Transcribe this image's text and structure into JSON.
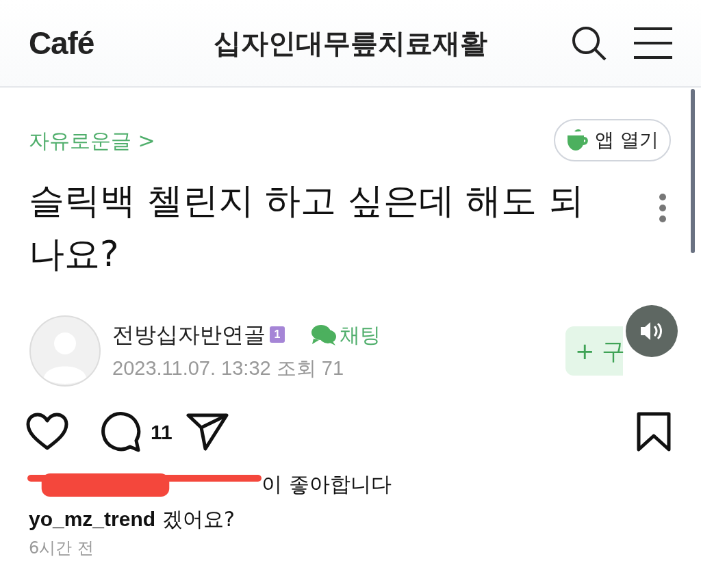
{
  "header": {
    "logo": "Café",
    "title": "십자인대무릎치료재활"
  },
  "post": {
    "board": "자유로운글 >",
    "open_app": "앱 열기",
    "title": "슬릭백 첼린지 하고 싶은데 해도 되나요?",
    "author": {
      "name": "전방십자반연골",
      "level": "1",
      "chat": "채팅",
      "meta": "2023.11.07. 13:32 조회 71"
    },
    "follow": "+ 구"
  },
  "actions": {
    "comment_count": "11"
  },
  "likes": "이 좋아합니다",
  "caption": {
    "user": "yo_mz_trend",
    "text": "겠어요?"
  },
  "time": "6시간 전"
}
